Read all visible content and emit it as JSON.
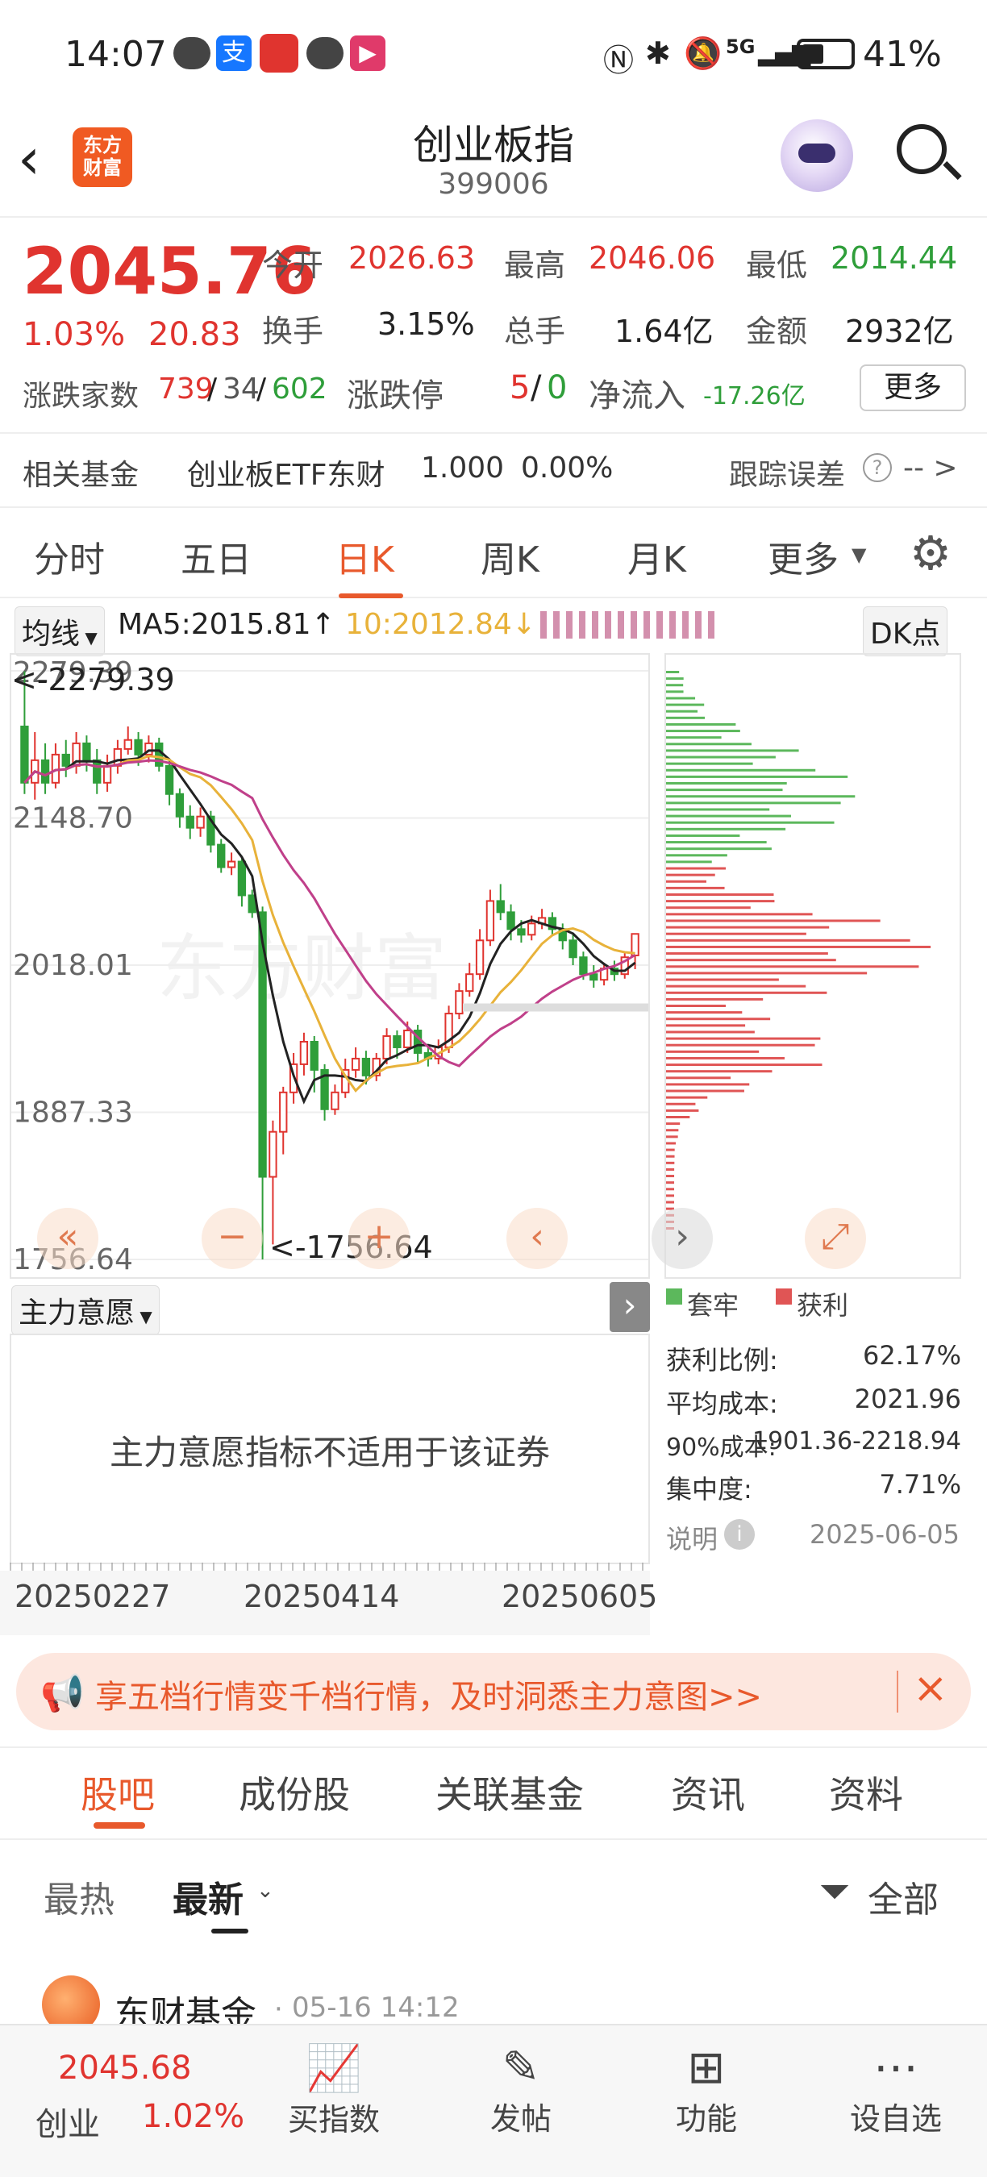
{
  "status_bar": {
    "time": "14:07",
    "network": "5G",
    "battery": "41%"
  },
  "header": {
    "title": "创业板指",
    "code": "399006",
    "logo_text_1": "东方",
    "logo_text_2": "财富"
  },
  "quote": {
    "price": "2045.76",
    "change_pct": "1.03%",
    "change": "20.83",
    "open_label": "今开",
    "open": "2026.63",
    "high_label": "最高",
    "high": "2046.06",
    "low_label": "最低",
    "low": "2014.44",
    "turnover_label": "换手",
    "turnover": "3.15%",
    "volume_label": "总手",
    "volume": "1.64亿",
    "amount_label": "金额",
    "amount": "2932亿",
    "updown_label": "涨跌家数",
    "up": "739",
    "flat": "34",
    "down": "602",
    "limit_label": "涨跌停",
    "limit_up": "5",
    "limit_down": "0",
    "inflow_label": "净流入",
    "inflow": "-17.26亿",
    "more_label": "更多"
  },
  "fund_row": {
    "label": "相关基金",
    "fund": "创业板ETF东财",
    "price": "1.000",
    "pct": "0.00%",
    "tracking_label": "跟踪误差",
    "tracking_value": "-- >"
  },
  "tabs": [
    "分时",
    "五日",
    "日K",
    "周K",
    "月K",
    "更多"
  ],
  "active_tab": "日K",
  "chart_header": {
    "indicator": "均线",
    "ma5": "MA5:2015.81↑",
    "ma10": "10:2012.84↓",
    "dk_label": "DK点"
  },
  "chart_data": {
    "type": "candlestick",
    "y_ticks": [
      "2279.39",
      "2148.70",
      "2018.01",
      "1887.33",
      "1756.64"
    ],
    "ylim": [
      1756.64,
      2279.39
    ],
    "x_ticks": [
      "20250227",
      "20250414",
      "20250605"
    ],
    "annotations": [
      "<-2279.39",
      "<-1756.64"
    ],
    "candles": [
      [
        2230,
        2180,
        2279,
        2170
      ],
      [
        2180,
        2200,
        2225,
        2165
      ],
      [
        2200,
        2180,
        2215,
        2170
      ],
      [
        2180,
        2205,
        2215,
        2175
      ],
      [
        2205,
        2195,
        2218,
        2185
      ],
      [
        2195,
        2215,
        2225,
        2188
      ],
      [
        2215,
        2200,
        2222,
        2190
      ],
      [
        2200,
        2180,
        2210,
        2170
      ],
      [
        2180,
        2195,
        2205,
        2172
      ],
      [
        2195,
        2210,
        2218,
        2188
      ],
      [
        2210,
        2218,
        2230,
        2205
      ],
      [
        2218,
        2205,
        2225,
        2195
      ],
      [
        2205,
        2215,
        2222,
        2198
      ],
      [
        2215,
        2195,
        2220,
        2190
      ],
      [
        2195,
        2170,
        2200,
        2160
      ],
      [
        2170,
        2150,
        2175,
        2140
      ],
      [
        2150,
        2140,
        2160,
        2130
      ],
      [
        2140,
        2150,
        2158,
        2132
      ],
      [
        2150,
        2125,
        2155,
        2118
      ],
      [
        2125,
        2105,
        2130,
        2100
      ],
      [
        2105,
        2110,
        2118,
        2098
      ],
      [
        2110,
        2080,
        2115,
        2070
      ],
      [
        2080,
        2065,
        2085,
        2060
      ],
      [
        2065,
        1830,
        2070,
        1756.64
      ],
      [
        1830,
        1870,
        1880,
        1770
      ],
      [
        1870,
        1905,
        1910,
        1850
      ],
      [
        1905,
        1930,
        1940,
        1895
      ],
      [
        1930,
        1950,
        1958,
        1920
      ],
      [
        1950,
        1925,
        1955,
        1905
      ],
      [
        1925,
        1890,
        1930,
        1880
      ],
      [
        1890,
        1905,
        1912,
        1885
      ],
      [
        1905,
        1925,
        1935,
        1900
      ],
      [
        1925,
        1935,
        1945,
        1918
      ],
      [
        1935,
        1920,
        1942,
        1912
      ],
      [
        1920,
        1935,
        1940,
        1915
      ],
      [
        1935,
        1955,
        1962,
        1930
      ],
      [
        1955,
        1945,
        1960,
        1935
      ],
      [
        1945,
        1960,
        1968,
        1940
      ],
      [
        1960,
        1940,
        1965,
        1932
      ],
      [
        1940,
        1935,
        1948,
        1928
      ],
      [
        1935,
        1945,
        1952,
        1930
      ],
      [
        1945,
        1975,
        1982,
        1940
      ],
      [
        1975,
        1995,
        2002,
        1970
      ],
      [
        1995,
        2010,
        2020,
        1990
      ],
      [
        2010,
        2040,
        2050,
        2005
      ],
      [
        2040,
        2075,
        2085,
        2035
      ],
      [
        2075,
        2065,
        2090,
        2058
      ],
      [
        2065,
        2050,
        2072,
        2040
      ],
      [
        2050,
        2045,
        2058,
        2038
      ],
      [
        2045,
        2055,
        2062,
        2040
      ],
      [
        2055,
        2060,
        2068,
        2050
      ],
      [
        2060,
        2050,
        2065,
        2045
      ],
      [
        2050,
        2040,
        2055,
        2032
      ],
      [
        2040,
        2025,
        2045,
        2018
      ],
      [
        2025,
        2010,
        2030,
        2005
      ],
      [
        2010,
        2005,
        2018,
        1998
      ],
      [
        2005,
        2015,
        2020,
        2000
      ],
      [
        2015,
        2010,
        2022,
        2004
      ],
      [
        2010,
        2025,
        2030,
        2006
      ],
      [
        2026.63,
        2045.76,
        2046.06,
        2014.44
      ]
    ]
  },
  "chip_panel": {
    "legend_trapped": "套牢",
    "legend_profit": "获利",
    "rows": [
      {
        "label": "获利比例:",
        "value": "62.17%"
      },
      {
        "label": "平均成本:",
        "value": "2021.96"
      },
      {
        "label": "90%成本:",
        "value": "1901.36-2218.94"
      },
      {
        "label": "集中度:",
        "value": "7.71%"
      }
    ],
    "explain_label": "说明",
    "date": "2025-06-05"
  },
  "main_force": {
    "label": "主力意愿",
    "message": "主力意愿指标不适用于该证券"
  },
  "banner": {
    "text": "享五档行情变千档行情，及时洞悉主力意图>>"
  },
  "bottom_tabs": [
    "股吧",
    "成份股",
    "关联基金",
    "资讯",
    "资料"
  ],
  "feed_tabs": {
    "hot": "最热",
    "new": "最新",
    "filter": "全部"
  },
  "post": {
    "author": "东财基金",
    "time": "05-16 14:12"
  },
  "bottom_nav": {
    "price": "2045.68",
    "name": "创业",
    "pct": "1.02%",
    "buy": "买指数",
    "post": "发帖",
    "func": "功能",
    "watch": "设自选"
  }
}
